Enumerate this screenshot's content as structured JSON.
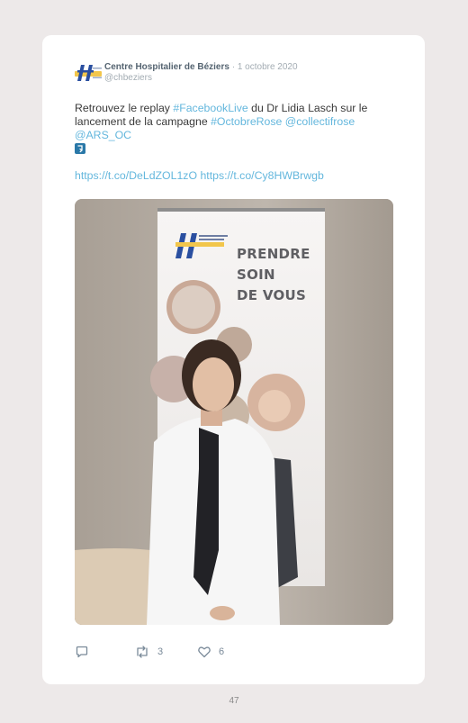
{
  "tweet": {
    "author": "Centre Hospitalier de Béziers",
    "separator": " · ",
    "date": "1 octobre 2020",
    "handle": "@chbeziers",
    "text_part1": "Retrouvez le replay ",
    "hashtag_facebooklive": "#FacebookLive",
    "text_part2": " du Dr Lidia Lasch sur le lancement de la campagne ",
    "hashtag_octobrerose": "#OctobreRose",
    "mention_collectifrose": "@collectifrose",
    "mention_ars_oc": "@ARS_OC",
    "link_1": "https://t.co/DeLdZOL1zO",
    "link_2": "https://t.co/Cy8HWBrwgb",
    "photo": {
      "banner_line1": "PRENDRE",
      "banner_line2": "SOIN",
      "banner_line3": "DE VOUS"
    },
    "actions": {
      "reply_icon": "reply-icon",
      "retweet_icon": "retweet-icon",
      "retweet_count": "3",
      "like_icon": "heart-icon",
      "like_count": "6"
    }
  },
  "page": {
    "number": "47"
  },
  "colors": {
    "background": "#ede9e9",
    "card": "#ffffff",
    "link": "#64b7dd",
    "author": "#556471",
    "meta": "#a3acb3",
    "icon": "#7a8a99"
  }
}
